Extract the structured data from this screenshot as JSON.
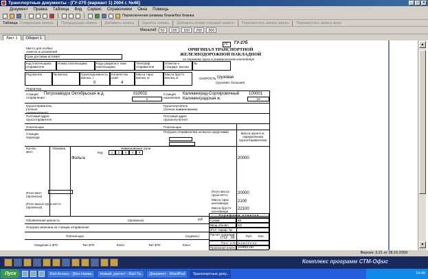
{
  "window": {
    "title": "Транспортные документы - [ГУ-27б (вариант 1) 2004 г. №46]"
  },
  "menu": [
    "Документ",
    "Правка",
    "Таблица",
    "Вид",
    "Сервис",
    "Справочники",
    "Окна",
    "Помощь"
  ],
  "toolbar1": {
    "mode_toggle": "Переключение режима бланк/без бланка"
  },
  "toolbar2": {
    "table_label": "Таблица",
    "items": [
      "Следующая запись",
      "Предыдущая запись",
      "Добавить запись",
      "Удалить запись",
      "Добавить копию текущей записи",
      "Переместить запись вверх",
      "Переместить запись вниз"
    ]
  },
  "toolbar3": {
    "zoom_label": "Масштаб",
    "zoom_options": [
      "50",
      "100",
      "150",
      "200",
      "300"
    ]
  },
  "sheet_tabs": [
    "Лист 1",
    "Оборот 1"
  ],
  "form": {
    "header_num": "20",
    "form_code": "ГУ-27б",
    "title1": "ОРИГИНАЛ ТРАНСПОРТНОЙ",
    "title2": "ЖЕЛЕЗНОДОРОЖНОЙ НАКЛАДНОЙ",
    "subtitle": "на перевозку груза в универсальном контейнере",
    "place_declaration": "Место для особых",
    "place_declaration2": "отметок и штемпелей",
    "delivery_term": "Срок доставки истекает",
    "num_label": "№",
    "row1": [
      "Код плательщика отправителя",
      "Номер плательщика",
      "Коды раздела и типа плательщика",
      "Телеграф отправителя",
      "Отметки о стандарт. вагона"
    ],
    "speed_label": "СКОРОСТЬ",
    "speed_value": "грузовая",
    "speed_note": "(грузовая, большая)",
    "row2": [
      "Род вагона",
      "№ вагона",
      "Грузоподъемность вагона, т",
      "Количество осей",
      "Масса тары вагона, кг",
      "Масса брутто вагона, кг"
    ],
    "row2_values": [
      "0",
      "4"
    ],
    "shipment_label": "Перевозка",
    "station_dep_label": "Станция отправления",
    "station_dep": "Петрозаводск Октябрьская ж.д.",
    "station_dep_code": "010002",
    "station_dep_code2": "1",
    "station_arr_label": "Станция назначения",
    "station_arr": "Калининград-Сортировочный Калининградская ж.",
    "station_arr_code": "100001",
    "station_arr_code2": "10",
    "sender_label": "Грузоотправитель (полное наименование)",
    "receiver_label": "Грузополучатель (полное наименование)",
    "postal_sender": "Почтовый адрес грузоотправителя",
    "postal_receiver": "Почтовый адрес грузополучателя",
    "payer_label": "Плательщик",
    "border_label": "Станции перехода",
    "request_label": "Погрузка отправителем на выгон средствами",
    "declared_value": "Объявленная ценность",
    "seals_label": "Пломбы",
    "col_headers": [
      "Кол-во мест",
      "Упаковка",
      "Наименование груза",
      "Масса груза в кг, определенная грузоотправителем"
    ],
    "code_label": "Код",
    "code_digits": [
      "1",
      "2",
      "3",
      "4",
      "5"
    ],
    "cargo_name": "Фольга",
    "cargo_mass": "20000",
    "total_places": "Итого мест (прописью)",
    "total_mass": "Итого масса груза нетто (прописью)",
    "mass_net_label": "Итого масса груза нетто",
    "mass_net": "20000",
    "tare_label": "Масса тары контейнера",
    "tare": "2100",
    "gross_label": "Масса брутто контейнера",
    "gross": "22100",
    "tariff_label": "Тарифные отметки",
    "scheme_label": "Схема",
    "scheme": "88",
    "distance_label": "Ввод.объявл",
    "distance": "КО",
    "tariff_distance_label": "Итог. тариф. №",
    "calc_weight_label": "Расчет платежей",
    "calc_value": "1712",
    "rub_label": "Руб.",
    "kop_label": "Коп.",
    "kop_value": "00",
    "departure_label": "При отправлении",
    "fare_label": "Провозная плата",
    "fare": "16450,00",
    "declared_units": "(прописью)",
    "rub_short": "руб",
    "responsible": "Погрузка записана на станции отправления",
    "signature_label": "(подпись)",
    "bottom_headers": [
      "Сведения о ЗПУ",
      "Тип ЗПУ",
      "Ключ",
      "Тип ЗПУ",
      "Ключ"
    ]
  },
  "status": {
    "version": "Версия: 3.21 от 28.10.2009"
  },
  "apptray": {
    "brand": "Комплекс программ СТМ-Офис"
  },
  "taskbar": {
    "start": "Пуск",
    "tasks": [
      "Rail-Агласс - [Без Назва...",
      "Новый_расчет - Rail-Та...",
      "Документ - WordPad",
      "Транспортные доку..."
    ],
    "clock": "14:46"
  }
}
